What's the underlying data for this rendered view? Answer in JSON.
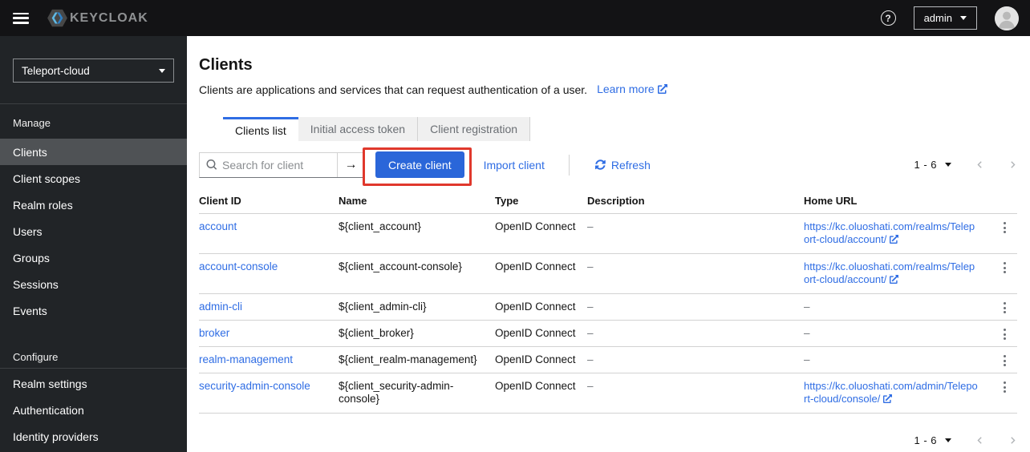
{
  "colors": {
    "accent_blue": "#2f6de4",
    "button_blue": "#2a66d9",
    "annotation_red": "#e0382c",
    "topbar_bg": "#131315",
    "sidebar_bg": "#212427",
    "sidebar_selected_bg": "#4f5255",
    "table_border": "#d2d2d2"
  },
  "topbar": {
    "brand_text": "KEYCLOAK",
    "help_symbol": "?",
    "user_label": "admin"
  },
  "sidebar": {
    "realm_selector": {
      "value": "Teleport-cloud"
    },
    "sections": [
      {
        "label": "Manage",
        "items": [
          {
            "label": "Clients"
          },
          {
            "label": "Client scopes"
          },
          {
            "label": "Realm roles"
          },
          {
            "label": "Users"
          },
          {
            "label": "Groups"
          },
          {
            "label": "Sessions"
          },
          {
            "label": "Events"
          }
        ]
      },
      {
        "label": "Configure",
        "items": [
          {
            "label": "Realm settings"
          },
          {
            "label": "Authentication"
          },
          {
            "label": "Identity providers"
          }
        ]
      }
    ]
  },
  "page": {
    "title": "Clients",
    "description": "Clients are applications and services that can request authentication of a user.",
    "learn_more_label": "Learn more"
  },
  "tabs": [
    {
      "label": "Clients list"
    },
    {
      "label": "Initial access token"
    },
    {
      "label": "Client registration"
    }
  ],
  "toolbar": {
    "search_placeholder": "Search for client",
    "search_submit": "→",
    "create_button": "Create client",
    "import_link": "Import client",
    "refresh_label": "Refresh"
  },
  "pagination": {
    "range": "1 - 6"
  },
  "table": {
    "columns": [
      "Client ID",
      "Name",
      "Type",
      "Description",
      "Home URL"
    ],
    "rows": [
      {
        "client_id": "account",
        "name": "${client_account}",
        "type": "OpenID Connect",
        "description": "–",
        "home_url": "https://kc.oluoshati.com/realms/Teleport-cloud/account/"
      },
      {
        "client_id": "account-console",
        "name": "${client_account-console}",
        "type": "OpenID Connect",
        "description": "–",
        "home_url": "https://kc.oluoshati.com/realms/Teleport-cloud/account/"
      },
      {
        "client_id": "admin-cli",
        "name": "${client_admin-cli}",
        "type": "OpenID Connect",
        "description": "–",
        "home_url": "–"
      },
      {
        "client_id": "broker",
        "name": "${client_broker}",
        "type": "OpenID Connect",
        "description": "–",
        "home_url": "–"
      },
      {
        "client_id": "realm-management",
        "name": "${client_realm-management}",
        "type": "OpenID Connect",
        "description": "–",
        "home_url": "–"
      },
      {
        "client_id": "security-admin-console",
        "name": "${client_security-admin-console}",
        "type": "OpenID Connect",
        "description": "–",
        "home_url": "https://kc.oluoshati.com/admin/Teleport-cloud/console/"
      }
    ]
  }
}
